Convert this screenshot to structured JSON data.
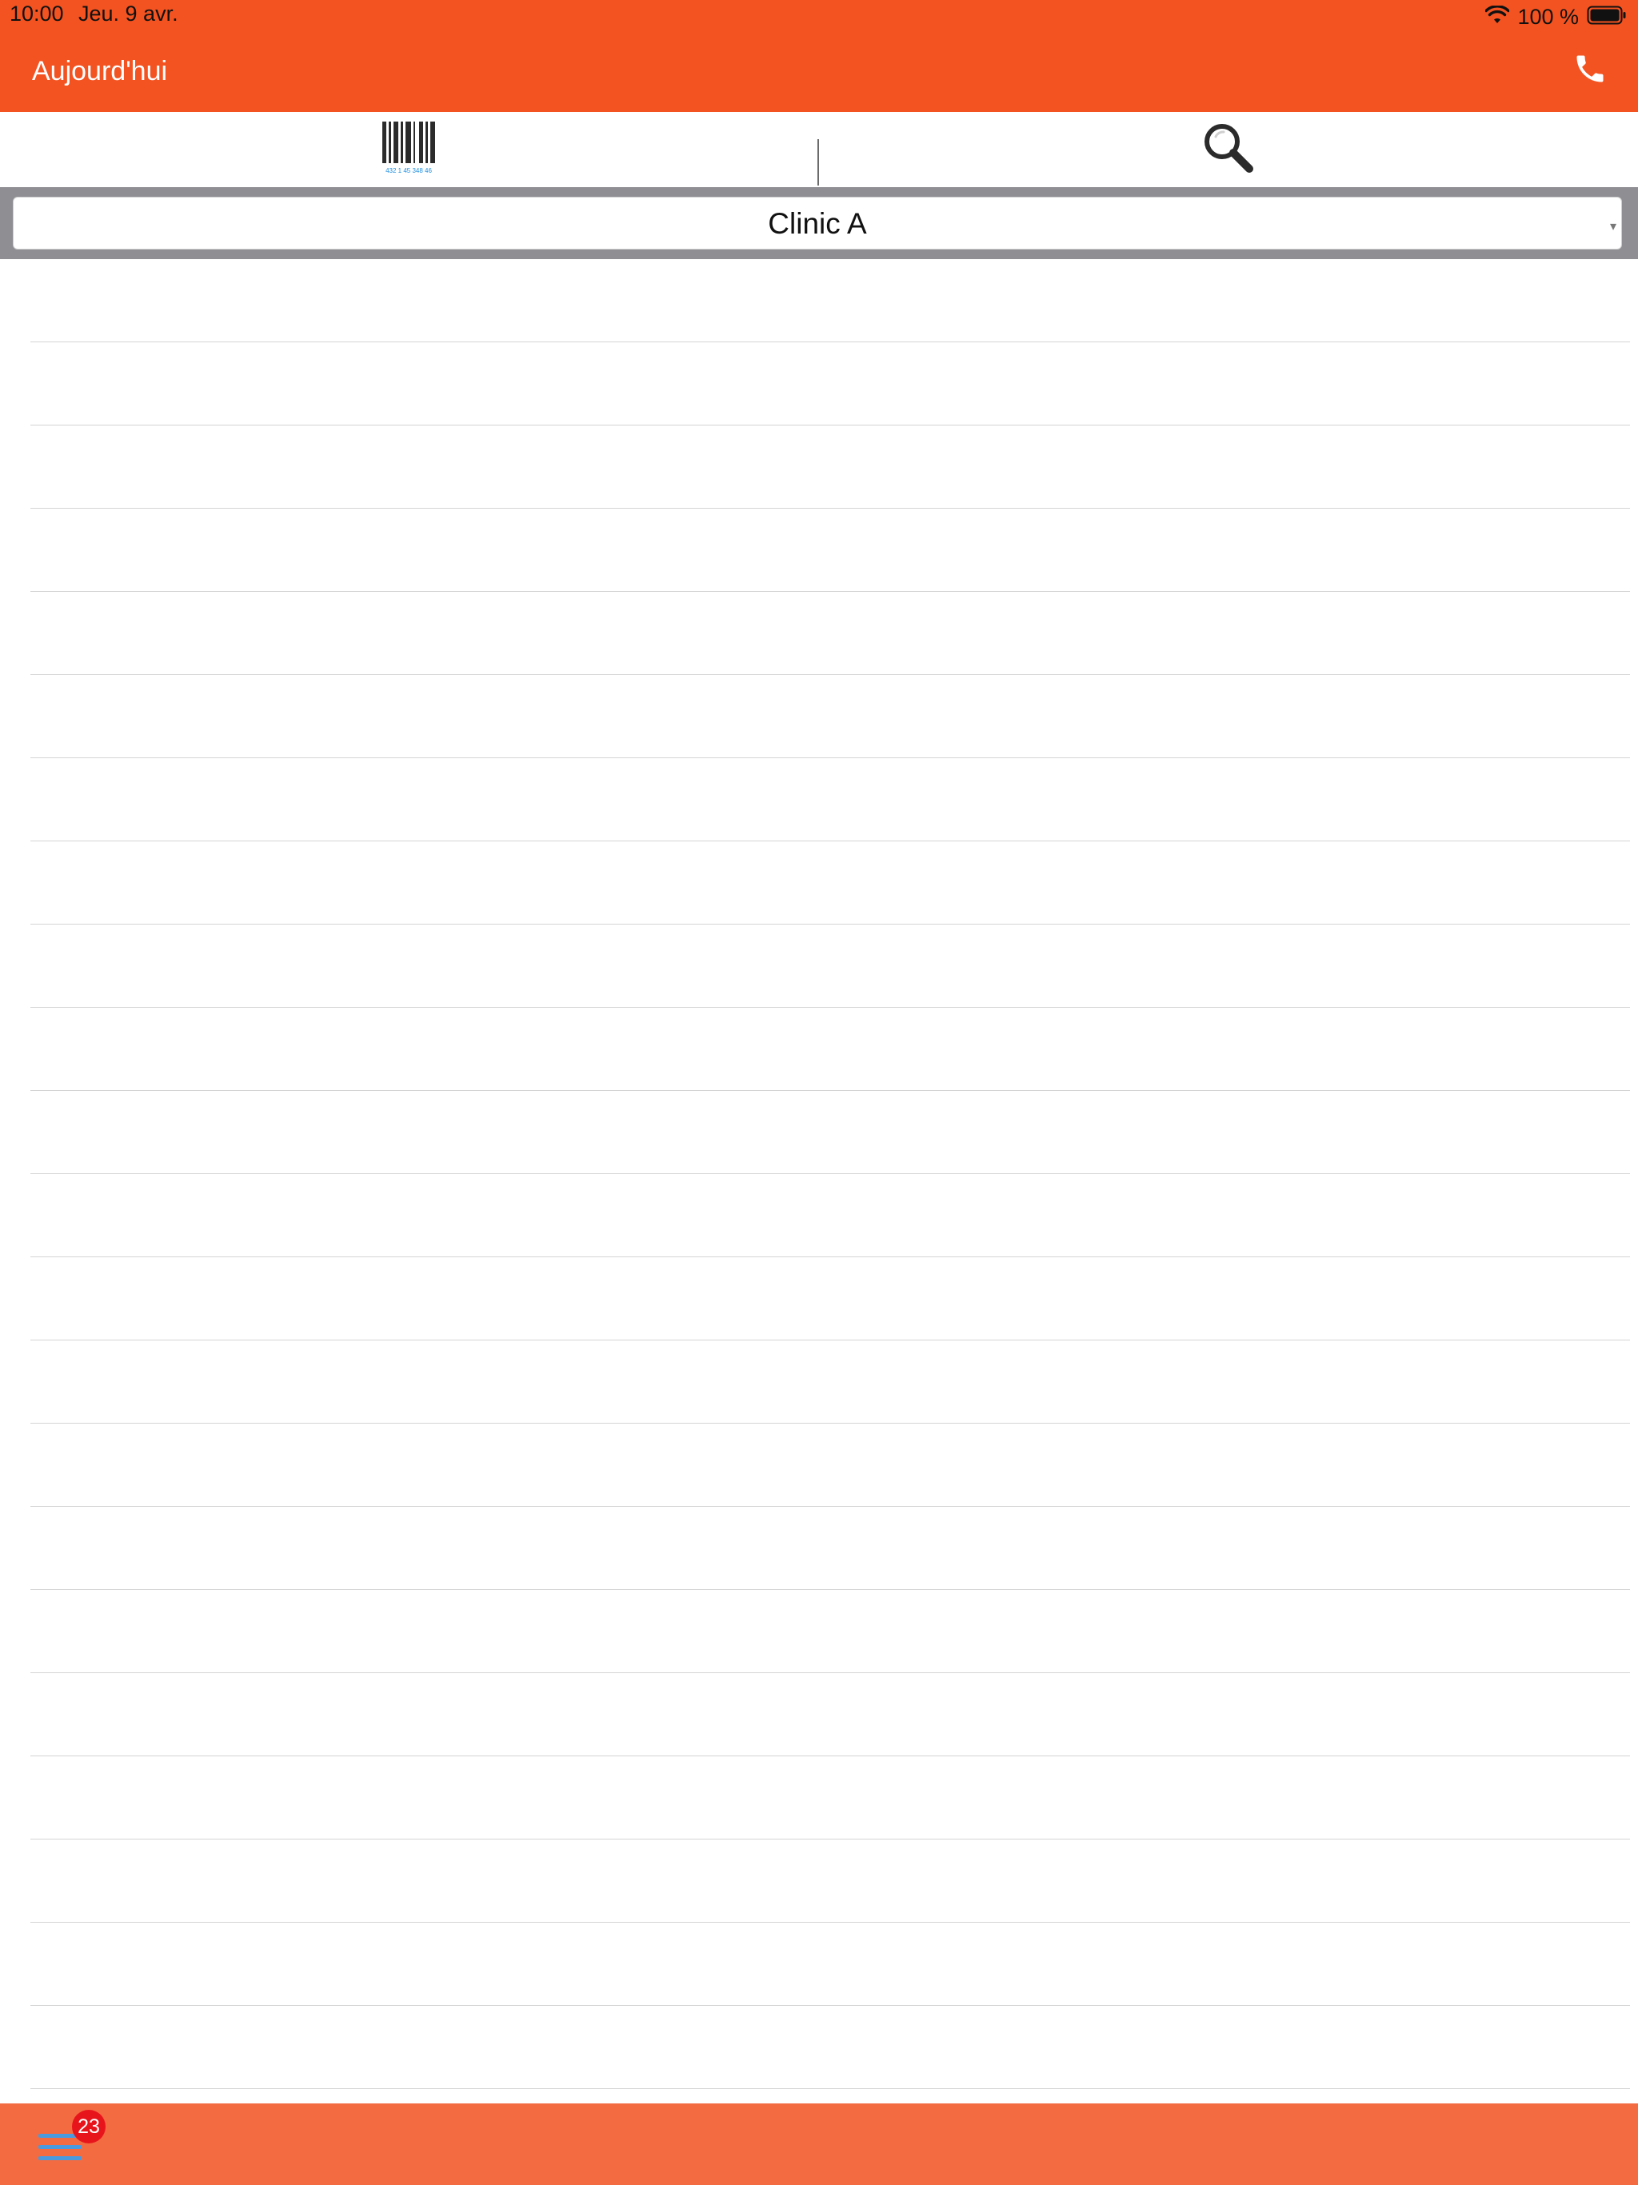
{
  "status_bar": {
    "time": "10:00",
    "date": "Jeu. 9 avr.",
    "battery_percent": "100 %",
    "wifi_icon": "wifi-icon",
    "battery_icon": "battery-icon"
  },
  "nav": {
    "title": "Aujourd'hui",
    "call_icon": "phone-icon"
  },
  "toolbar": {
    "barcode_icon": "barcode-icon",
    "barcode_digits": "432 1 45 348 46",
    "search_icon": "search-icon"
  },
  "clinic_picker": {
    "selected": "Clinic A",
    "caret_icon": "caret-down-icon"
  },
  "list": {
    "empty_rows": 22
  },
  "bottom_bar": {
    "menu_icon": "hamburger-menu-icon",
    "badge_count": "23"
  },
  "colors": {
    "header": "#F35321",
    "bottom_bar": "#F36B41",
    "picker_band": "#8E8E93",
    "menu_icon": "#4A9AE0",
    "badge": "#E8141C",
    "barcode_digits": "#1E8FE0"
  }
}
